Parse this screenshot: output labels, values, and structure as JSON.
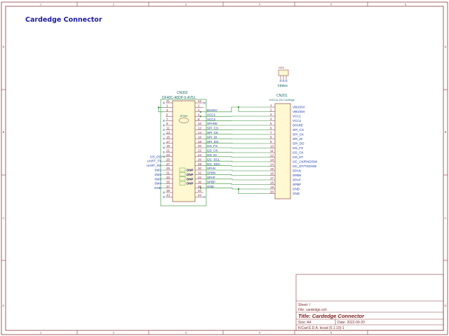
{
  "page_title": "Cardedge Connector",
  "border": {
    "cols_top": [
      "1",
      "2",
      "3",
      "4",
      "5",
      "6"
    ],
    "rows": [
      "A",
      "B",
      "C",
      "D"
    ]
  },
  "title_block": {
    "sheet": "Sheet: /",
    "file": "File: cardedge.sch",
    "title": "Title: Cardedge Connector",
    "size": "Size: A4",
    "date": "Date: 2022-09-20",
    "tool": "KiCad E.D.A.  kicad (5.1.10)-1"
  },
  "cn302": {
    "ref": "CN302",
    "value": "DF40C-40DP-0.4V51",
    "left_pins": [
      "41",
      "1",
      "3",
      "5",
      "7",
      "9",
      "11",
      "13",
      "15",
      "17",
      "19",
      "21",
      "23",
      "25",
      "27",
      "29",
      "31",
      "33",
      "35",
      "37",
      "39",
      "43"
    ],
    "right_pins": [
      "42",
      "2",
      "4",
      "6",
      "8",
      "10",
      "12",
      "14",
      "16",
      "18",
      "20",
      "22",
      "24",
      "26",
      "28",
      "30",
      "32",
      "34",
      "36",
      "38",
      "40",
      "44"
    ],
    "right_nets": [
      "",
      "",
      "BUS5V",
      "VCC1",
      "VCC2",
      "SPARE",
      "SPI_CS",
      "SPI_CK",
      "SPI_DI",
      "SPI_DO",
      "I2S_FS",
      "I2S_CK",
      "I2S_DI",
      "I2C_SCL",
      "I2C_SDA",
      "SPAN",
      "SPBN",
      "SPAP",
      "SPBP",
      "GND",
      "",
      ""
    ],
    "left_labels": [
      "I2S_DO",
      "UART_TX",
      "UART_RX",
      "SW1",
      "SW2",
      "SW3",
      "SW4",
      "GND"
    ],
    "dnp": [
      "DNP",
      "DNP",
      "DNP",
      "DNP"
    ],
    "jp_ref": "JP303"
  },
  "cn201": {
    "ref": "CN201",
    "value": "ESCCA-120-CardEdge",
    "pins": [
      "1",
      "2",
      "3",
      "4",
      "5",
      "6",
      "7",
      "8",
      "9",
      "10",
      "11",
      "12",
      "13",
      "14",
      "15",
      "16",
      "17",
      "18",
      "19",
      "20"
    ],
    "nets": [
      "VBUS5V",
      "VBUS5V",
      "VCC1",
      "VCC2",
      "SPARE",
      "SPI_CS",
      "SPI_CK",
      "SPI_DI",
      "SPI_DO",
      "I2S_FS",
      "I2S_CK",
      "I2S_DT",
      "I2C_CK/RXD/SW",
      "I2C_DT/TXD/SW",
      "SPAN",
      "SPBN",
      "SPAP",
      "SPBP",
      "GND",
      "GND"
    ]
  },
  "holes": {
    "ref": "H201",
    "label": "Holes"
  }
}
